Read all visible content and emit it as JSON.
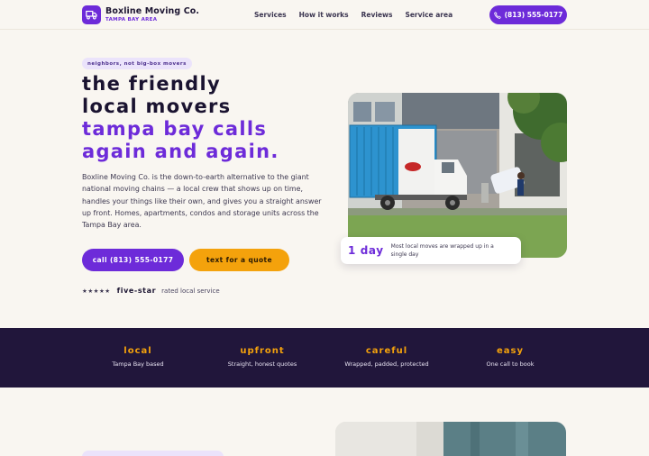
{
  "brand": {
    "name": "Boxline Moving Co.",
    "tagline": "TAMPA BAY AREA",
    "icon": "truck-icon"
  },
  "nav": {
    "links": [
      "Services",
      "How it works",
      "Reviews",
      "Service area"
    ],
    "phone": "(813) 555-0177"
  },
  "hero": {
    "badge": "NEIGHBORS, NOT BIG-BOX MOVERS",
    "title_line1": "The friendly",
    "title_line2": "local movers",
    "title_line3": "Tampa Bay calls",
    "title_line4": "again and again.",
    "lead": "Boxline Moving Co. is the down-to-earth alternative to the giant national moving chains — a local crew that shows up on time, handles your things like their own, and gives you a straight answer up front. Homes, apartments, condos and storage units across the Tampa Bay area.",
    "call_button": "Call (813) 555-0177",
    "quote_button": "Text for a quote",
    "stars": "★★★★★",
    "rating_label": "Five-star",
    "rating_sub": "rated local service"
  },
  "stat": {
    "value": "1 day",
    "text": "Most local moves are wrapped up in a single day"
  },
  "features": [
    {
      "title": "Local",
      "sub": "Tampa Bay based"
    },
    {
      "title": "Upfront",
      "sub": "Straight, honest quotes"
    },
    {
      "title": "Careful",
      "sub": "Wrapped, padded, protected"
    },
    {
      "title": "Easy",
      "sub": "One call to book"
    }
  ],
  "colors": {
    "accent": "#6d2bd9",
    "orange": "#f4a20c",
    "band": "#21163b",
    "background": "#f9f6f1"
  }
}
